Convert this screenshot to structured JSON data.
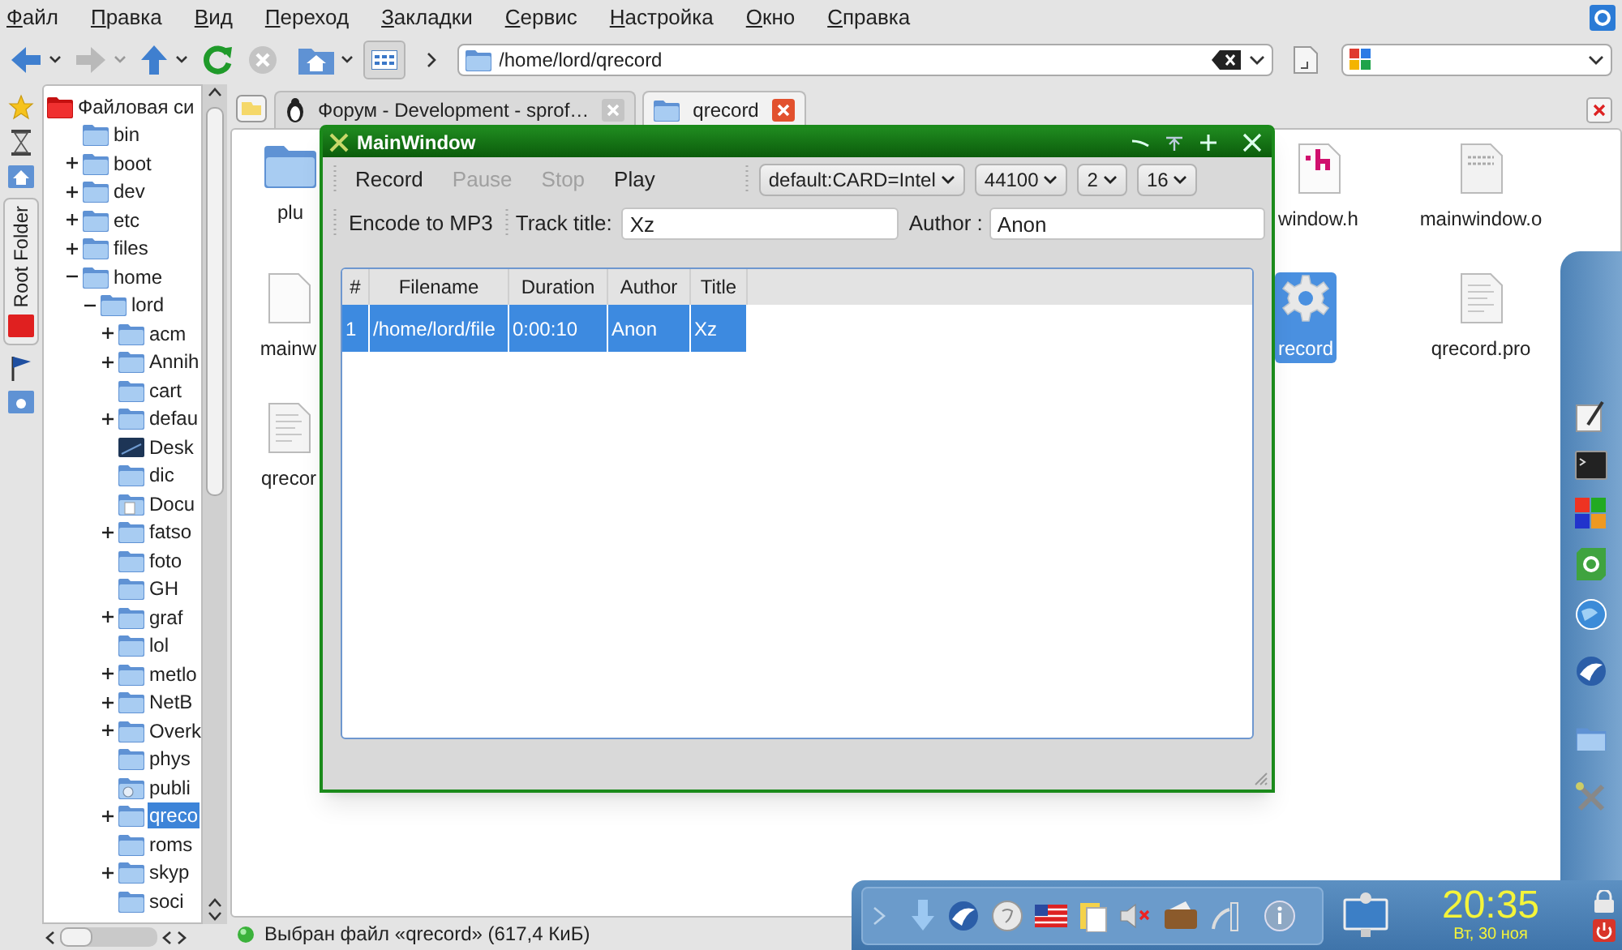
{
  "menu": [
    "Файл",
    "Правка",
    "Вид",
    "Переход",
    "Закладки",
    "Сервис",
    "Настройка",
    "Окно",
    "Справка"
  ],
  "address": {
    "value": "/home/lord/qrecord"
  },
  "side_tabs": [
    {
      "label": "Root Folder",
      "selected": true
    }
  ],
  "tree": [
    {
      "label": "Файловая си",
      "kind": "root",
      "selected": false,
      "children": [
        {
          "label": "bin",
          "kind": "folder",
          "selected": false
        },
        {
          "label": "boot",
          "kind": "folder",
          "expanded": false,
          "selected": false
        },
        {
          "label": "dev",
          "kind": "folder",
          "expanded": false,
          "selected": false
        },
        {
          "label": "etc",
          "kind": "folder",
          "expanded": false,
          "selected": false
        },
        {
          "label": "files",
          "kind": "folder",
          "expanded": false,
          "selected": false
        },
        {
          "label": "home",
          "kind": "folder",
          "expanded": true,
          "selected": false,
          "children": [
            {
              "label": "lord",
              "kind": "folder",
              "expanded": true,
              "selected": false,
              "children": [
                {
                  "label": "acm",
                  "kind": "folder",
                  "expanded": false,
                  "selected": false
                },
                {
                  "label": "Annih",
                  "kind": "folder",
                  "expanded": false,
                  "selected": false
                },
                {
                  "label": "cart",
                  "kind": "folder",
                  "selected": false
                },
                {
                  "label": "defau",
                  "kind": "folder",
                  "expanded": false,
                  "selected": false
                },
                {
                  "label": "Desk",
                  "kind": "desktop",
                  "selected": false
                },
                {
                  "label": "dic",
                  "kind": "folder",
                  "selected": false
                },
                {
                  "label": "Docu",
                  "kind": "documents",
                  "selected": false
                },
                {
                  "label": "fatso",
                  "kind": "folder",
                  "expanded": false,
                  "selected": false
                },
                {
                  "label": "foto",
                  "kind": "folder",
                  "selected": false
                },
                {
                  "label": "GH",
                  "kind": "folder",
                  "selected": false
                },
                {
                  "label": "graf",
                  "kind": "folder",
                  "expanded": false,
                  "selected": false
                },
                {
                  "label": "lol",
                  "kind": "folder",
                  "selected": false
                },
                {
                  "label": "metlo",
                  "kind": "folder",
                  "expanded": false,
                  "selected": false
                },
                {
                  "label": "NetB",
                  "kind": "folder",
                  "expanded": false,
                  "selected": false
                },
                {
                  "label": "Overk",
                  "kind": "folder",
                  "expanded": false,
                  "selected": false
                },
                {
                  "label": "phys",
                  "kind": "folder",
                  "selected": false
                },
                {
                  "label": "publi",
                  "kind": "public",
                  "selected": false
                },
                {
                  "label": "qreco",
                  "kind": "folder",
                  "expanded": false,
                  "selected": true
                },
                {
                  "label": "roms",
                  "kind": "folder",
                  "selected": false
                },
                {
                  "label": "skyp",
                  "kind": "folder",
                  "expanded": false,
                  "selected": false
                },
                {
                  "label": "soci",
                  "kind": "folder",
                  "selected": false
                }
              ]
            }
          ]
        }
      ]
    }
  ],
  "tabs": [
    {
      "label": "Форум - Development - sprof…",
      "kind": "web",
      "selected": false
    },
    {
      "label": "qrecord",
      "kind": "folder",
      "selected": true
    }
  ],
  "files": [
    {
      "label": "plu",
      "kind": "folder",
      "selected": false
    },
    {
      "label": "mainw",
      "kind": "source",
      "selected": false
    },
    {
      "label": "qrecor",
      "kind": "text",
      "selected": false
    },
    {
      "label": "window.h",
      "kind": "header",
      "selected": false
    },
    {
      "label": "mainwindow.o",
      "kind": "object",
      "selected": false
    },
    {
      "label": "record",
      "kind": "executable",
      "selected": true
    },
    {
      "label": "qrecord.pro",
      "kind": "text",
      "selected": false
    }
  ],
  "status_bar": "Выбран файл «qrecord» (617,4 КиБ)",
  "app_window": {
    "title": "MainWindow",
    "actions": [
      {
        "label": "Record",
        "disabled": false
      },
      {
        "label": "Pause",
        "disabled": true
      },
      {
        "label": "Stop",
        "disabled": true
      },
      {
        "label": "Play",
        "disabled": false
      }
    ],
    "selects": [
      "default:CARD=Intel",
      "44100",
      "2",
      "16"
    ],
    "encode": "Encode to MP3",
    "track_title": {
      "label": "Track title:",
      "value": "Xz"
    },
    "author": {
      "label": "Author :",
      "value": "Anon"
    },
    "table": {
      "columns": [
        "#",
        "Filename",
        "Duration",
        "Author",
        "Title"
      ],
      "rows": [
        {
          "cells": [
            "1",
            "/home/lord/file",
            "0:00:10",
            "Anon",
            "Xz"
          ],
          "selected": true
        }
      ]
    }
  },
  "panel": {
    "time": "20:35",
    "date": "Вт, 30 ноя"
  }
}
